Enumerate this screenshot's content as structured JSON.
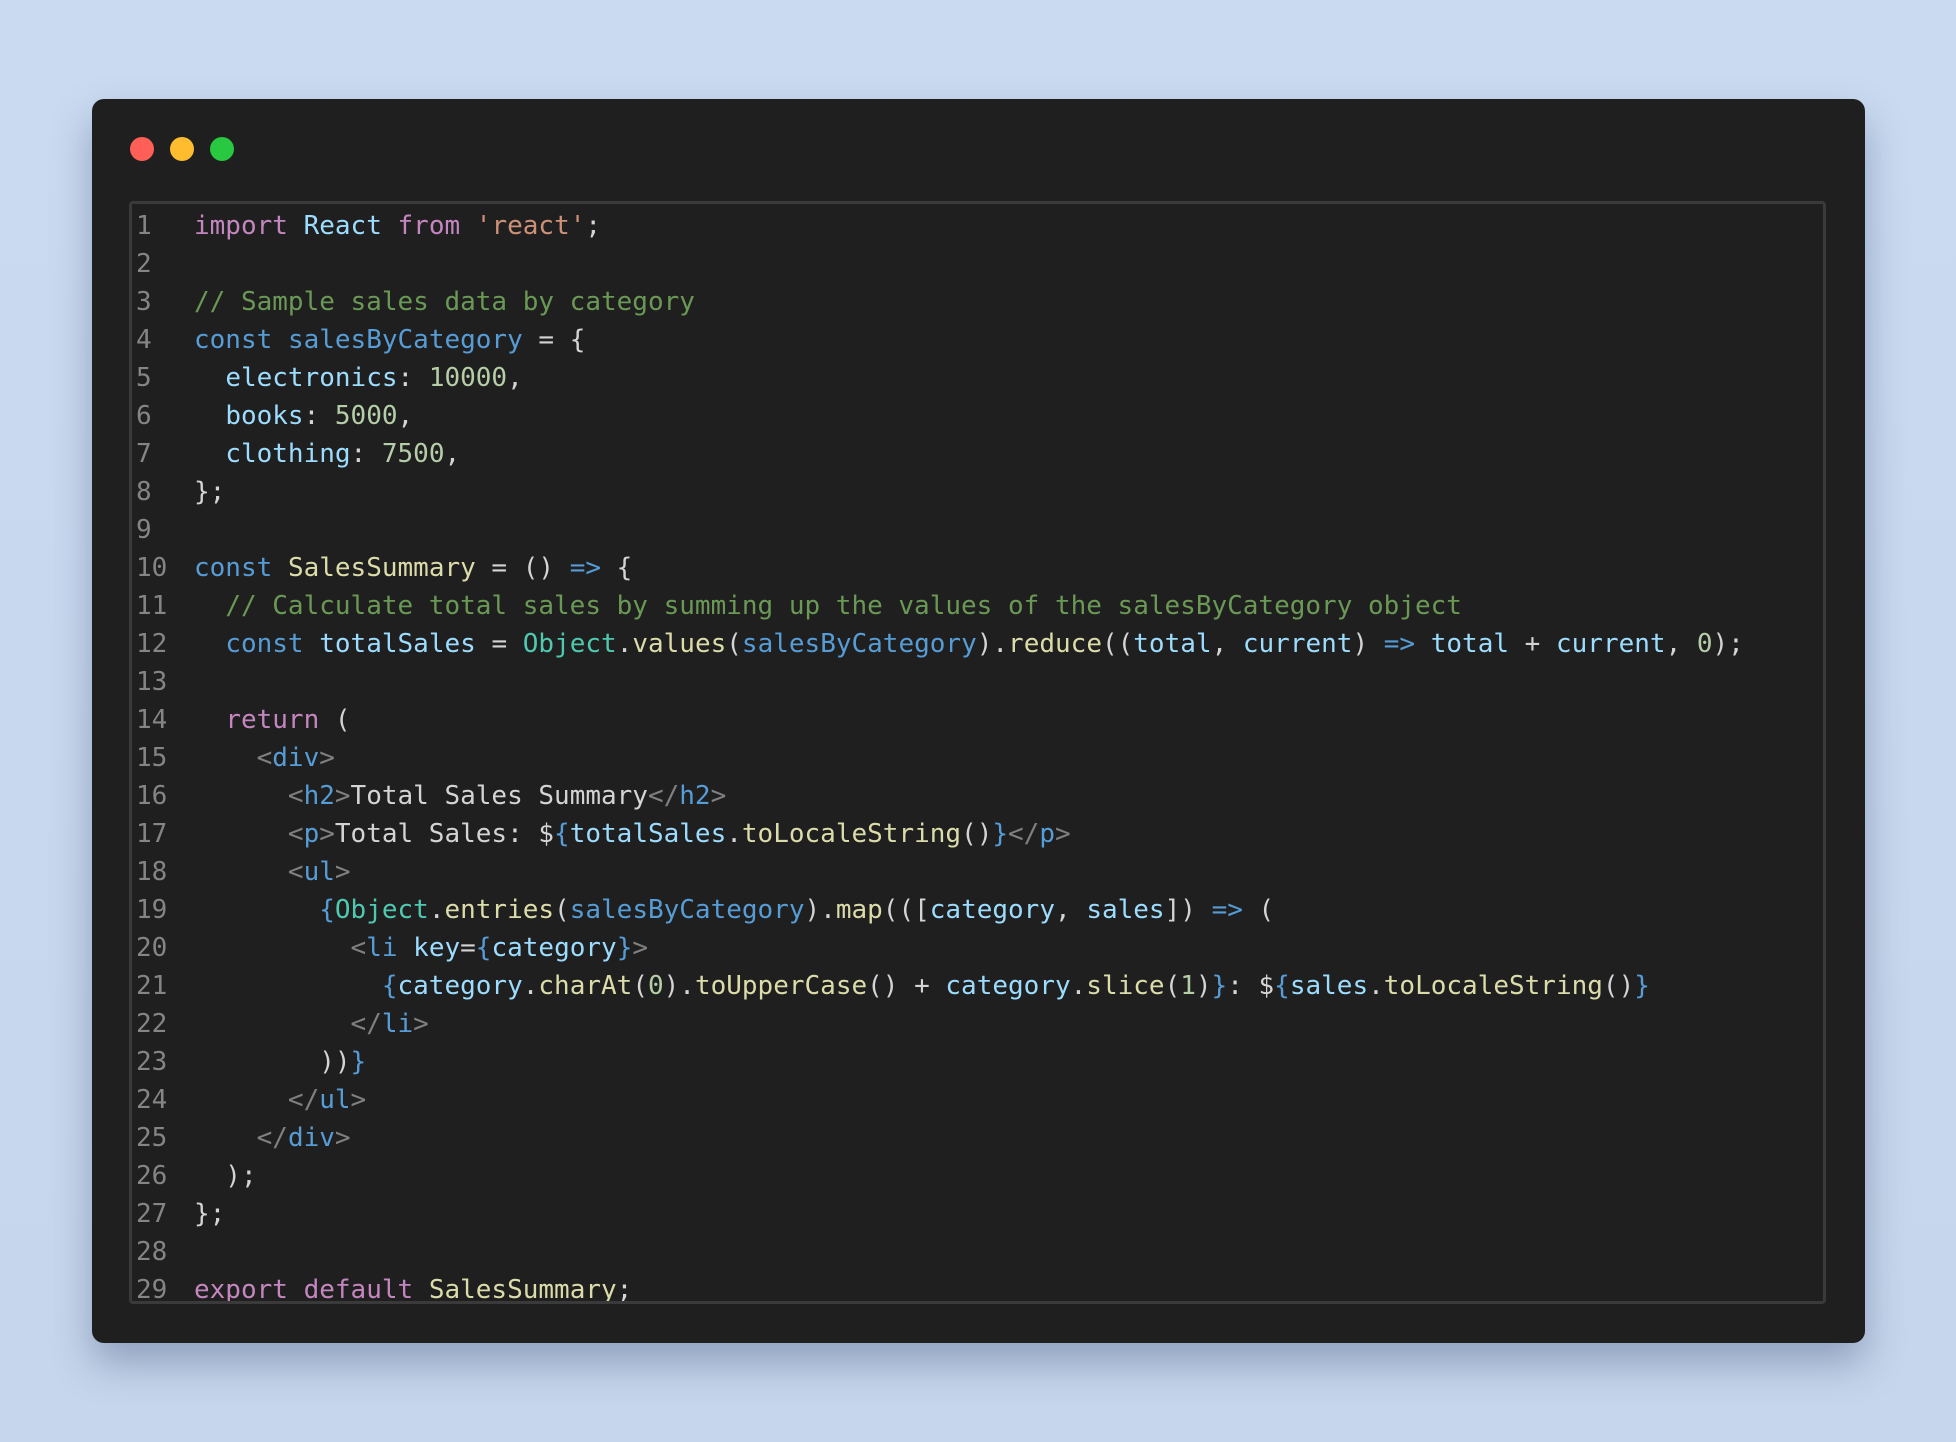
{
  "window": {
    "controls": [
      "close",
      "minimize",
      "maximize"
    ],
    "colors": {
      "close": "#ff5f57",
      "minimize": "#febc2e",
      "maximize": "#28c840"
    }
  },
  "editor": {
    "lines": [
      {
        "n": "1",
        "tokens": [
          [
            "kw",
            "import"
          ],
          [
            "pl",
            " "
          ],
          [
            "vr",
            "React"
          ],
          [
            "pl",
            " "
          ],
          [
            "kw",
            "from"
          ],
          [
            "pl",
            " "
          ],
          [
            "st",
            "'react'"
          ],
          [
            "pl",
            ";"
          ]
        ]
      },
      {
        "n": "2",
        "tokens": []
      },
      {
        "n": "3",
        "tokens": [
          [
            "cm",
            "// Sample sales data by category"
          ]
        ]
      },
      {
        "n": "4",
        "tokens": [
          [
            "bl",
            "const"
          ],
          [
            "pl",
            " "
          ],
          [
            "bl",
            "salesByCategory"
          ],
          [
            "pl",
            " = {"
          ]
        ]
      },
      {
        "n": "5",
        "tokens": [
          [
            "pl",
            "  "
          ],
          [
            "vr",
            "electronics"
          ],
          [
            "pl",
            ": "
          ],
          [
            "nm",
            "10000"
          ],
          [
            "pl",
            ","
          ]
        ]
      },
      {
        "n": "6",
        "tokens": [
          [
            "pl",
            "  "
          ],
          [
            "vr",
            "books"
          ],
          [
            "pl",
            ": "
          ],
          [
            "nm",
            "5000"
          ],
          [
            "pl",
            ","
          ]
        ]
      },
      {
        "n": "7",
        "tokens": [
          [
            "pl",
            "  "
          ],
          [
            "vr",
            "clothing"
          ],
          [
            "pl",
            ": "
          ],
          [
            "nm",
            "7500"
          ],
          [
            "pl",
            ","
          ]
        ]
      },
      {
        "n": "8",
        "tokens": [
          [
            "pl",
            "};"
          ]
        ]
      },
      {
        "n": "9",
        "tokens": []
      },
      {
        "n": "10",
        "tokens": [
          [
            "bl",
            "const"
          ],
          [
            "pl",
            " "
          ],
          [
            "fn",
            "SalesSummary"
          ],
          [
            "pl",
            " = () "
          ],
          [
            "bl",
            "=>"
          ],
          [
            "pl",
            " {"
          ]
        ]
      },
      {
        "n": "11",
        "tokens": [
          [
            "pl",
            "  "
          ],
          [
            "cm",
            "// Calculate total sales by summing up the values of the salesByCategory object"
          ]
        ]
      },
      {
        "n": "12",
        "tokens": [
          [
            "pl",
            "  "
          ],
          [
            "bl",
            "const"
          ],
          [
            "pl",
            " "
          ],
          [
            "vr",
            "totalSales"
          ],
          [
            "pl",
            " = "
          ],
          [
            "tp",
            "Object"
          ],
          [
            "pl",
            "."
          ],
          [
            "fn",
            "values"
          ],
          [
            "pl",
            "("
          ],
          [
            "bl",
            "salesByCategory"
          ],
          [
            "pl",
            ")."
          ],
          [
            "fn",
            "reduce"
          ],
          [
            "pl",
            "(("
          ],
          [
            "vr",
            "total"
          ],
          [
            "pl",
            ", "
          ],
          [
            "vr",
            "current"
          ],
          [
            "pl",
            ") "
          ],
          [
            "bl",
            "=>"
          ],
          [
            "pl",
            " "
          ],
          [
            "vr",
            "total"
          ],
          [
            "pl",
            " + "
          ],
          [
            "vr",
            "current"
          ],
          [
            "pl",
            ", "
          ],
          [
            "nm",
            "0"
          ],
          [
            "pl",
            ");"
          ]
        ]
      },
      {
        "n": "13",
        "tokens": []
      },
      {
        "n": "14",
        "tokens": [
          [
            "pl",
            "  "
          ],
          [
            "kw",
            "return"
          ],
          [
            "pl",
            " ("
          ]
        ]
      },
      {
        "n": "15",
        "tokens": [
          [
            "pl",
            "    "
          ],
          [
            "tg",
            "<"
          ],
          [
            "bl",
            "div"
          ],
          [
            "tg",
            ">"
          ]
        ]
      },
      {
        "n": "16",
        "tokens": [
          [
            "pl",
            "      "
          ],
          [
            "tg",
            "<"
          ],
          [
            "bl",
            "h2"
          ],
          [
            "tg",
            ">"
          ],
          [
            "pl",
            "Total Sales Summary"
          ],
          [
            "tg",
            "</"
          ],
          [
            "bl",
            "h2"
          ],
          [
            "tg",
            ">"
          ]
        ]
      },
      {
        "n": "17",
        "tokens": [
          [
            "pl",
            "      "
          ],
          [
            "tg",
            "<"
          ],
          [
            "bl",
            "p"
          ],
          [
            "tg",
            ">"
          ],
          [
            "pl",
            "Total Sales: $"
          ],
          [
            "bl",
            "{"
          ],
          [
            "vr",
            "totalSales"
          ],
          [
            "pl",
            "."
          ],
          [
            "fn",
            "toLocaleString"
          ],
          [
            "pl",
            "()"
          ],
          [
            "bl",
            "}"
          ],
          [
            "tg",
            "</"
          ],
          [
            "bl",
            "p"
          ],
          [
            "tg",
            ">"
          ]
        ]
      },
      {
        "n": "18",
        "tokens": [
          [
            "pl",
            "      "
          ],
          [
            "tg",
            "<"
          ],
          [
            "bl",
            "ul"
          ],
          [
            "tg",
            ">"
          ]
        ]
      },
      {
        "n": "19",
        "tokens": [
          [
            "pl",
            "        "
          ],
          [
            "bl",
            "{"
          ],
          [
            "tp",
            "Object"
          ],
          [
            "pl",
            "."
          ],
          [
            "fn",
            "entries"
          ],
          [
            "pl",
            "("
          ],
          [
            "bl",
            "salesByCategory"
          ],
          [
            "pl",
            ")."
          ],
          [
            "fn",
            "map"
          ],
          [
            "pl",
            "((["
          ],
          [
            "vr",
            "category"
          ],
          [
            "pl",
            ", "
          ],
          [
            "vr",
            "sales"
          ],
          [
            "pl",
            "]) "
          ],
          [
            "bl",
            "=>"
          ],
          [
            "pl",
            " ("
          ]
        ]
      },
      {
        "n": "20",
        "tokens": [
          [
            "pl",
            "          "
          ],
          [
            "tg",
            "<"
          ],
          [
            "bl",
            "li"
          ],
          [
            "pl",
            " "
          ],
          [
            "vr",
            "key"
          ],
          [
            "pl",
            "="
          ],
          [
            "bl",
            "{"
          ],
          [
            "vr",
            "category"
          ],
          [
            "bl",
            "}"
          ],
          [
            "tg",
            ">"
          ]
        ]
      },
      {
        "n": "21",
        "tokens": [
          [
            "pl",
            "            "
          ],
          [
            "bl",
            "{"
          ],
          [
            "vr",
            "category"
          ],
          [
            "pl",
            "."
          ],
          [
            "fn",
            "charAt"
          ],
          [
            "pl",
            "("
          ],
          [
            "nm",
            "0"
          ],
          [
            "pl",
            ")."
          ],
          [
            "fn",
            "toUpperCase"
          ],
          [
            "pl",
            "() + "
          ],
          [
            "vr",
            "category"
          ],
          [
            "pl",
            "."
          ],
          [
            "fn",
            "slice"
          ],
          [
            "pl",
            "("
          ],
          [
            "nm",
            "1"
          ],
          [
            "pl",
            ")"
          ],
          [
            "bl",
            "}"
          ],
          [
            "pl",
            ": $"
          ],
          [
            "bl",
            "{"
          ],
          [
            "vr",
            "sales"
          ],
          [
            "pl",
            "."
          ],
          [
            "fn",
            "toLocaleString"
          ],
          [
            "pl",
            "()"
          ],
          [
            "bl",
            "}"
          ]
        ]
      },
      {
        "n": "22",
        "tokens": [
          [
            "pl",
            "          "
          ],
          [
            "tg",
            "</"
          ],
          [
            "bl",
            "li"
          ],
          [
            "tg",
            ">"
          ]
        ]
      },
      {
        "n": "23",
        "tokens": [
          [
            "pl",
            "        ))"
          ],
          [
            "bl",
            "}"
          ]
        ]
      },
      {
        "n": "24",
        "tokens": [
          [
            "pl",
            "      "
          ],
          [
            "tg",
            "</"
          ],
          [
            "bl",
            "ul"
          ],
          [
            "tg",
            ">"
          ]
        ]
      },
      {
        "n": "25",
        "tokens": [
          [
            "pl",
            "    "
          ],
          [
            "tg",
            "</"
          ],
          [
            "bl",
            "div"
          ],
          [
            "tg",
            ">"
          ]
        ]
      },
      {
        "n": "26",
        "tokens": [
          [
            "pl",
            "  );"
          ]
        ]
      },
      {
        "n": "27",
        "tokens": [
          [
            "pl",
            "};"
          ]
        ]
      },
      {
        "n": "28",
        "tokens": []
      },
      {
        "n": "29",
        "tokens": [
          [
            "kw",
            "export"
          ],
          [
            "pl",
            " "
          ],
          [
            "kw",
            "default"
          ],
          [
            "pl",
            " "
          ],
          [
            "fn",
            "SalesSummary"
          ],
          [
            "pl",
            ";"
          ]
        ]
      }
    ]
  }
}
